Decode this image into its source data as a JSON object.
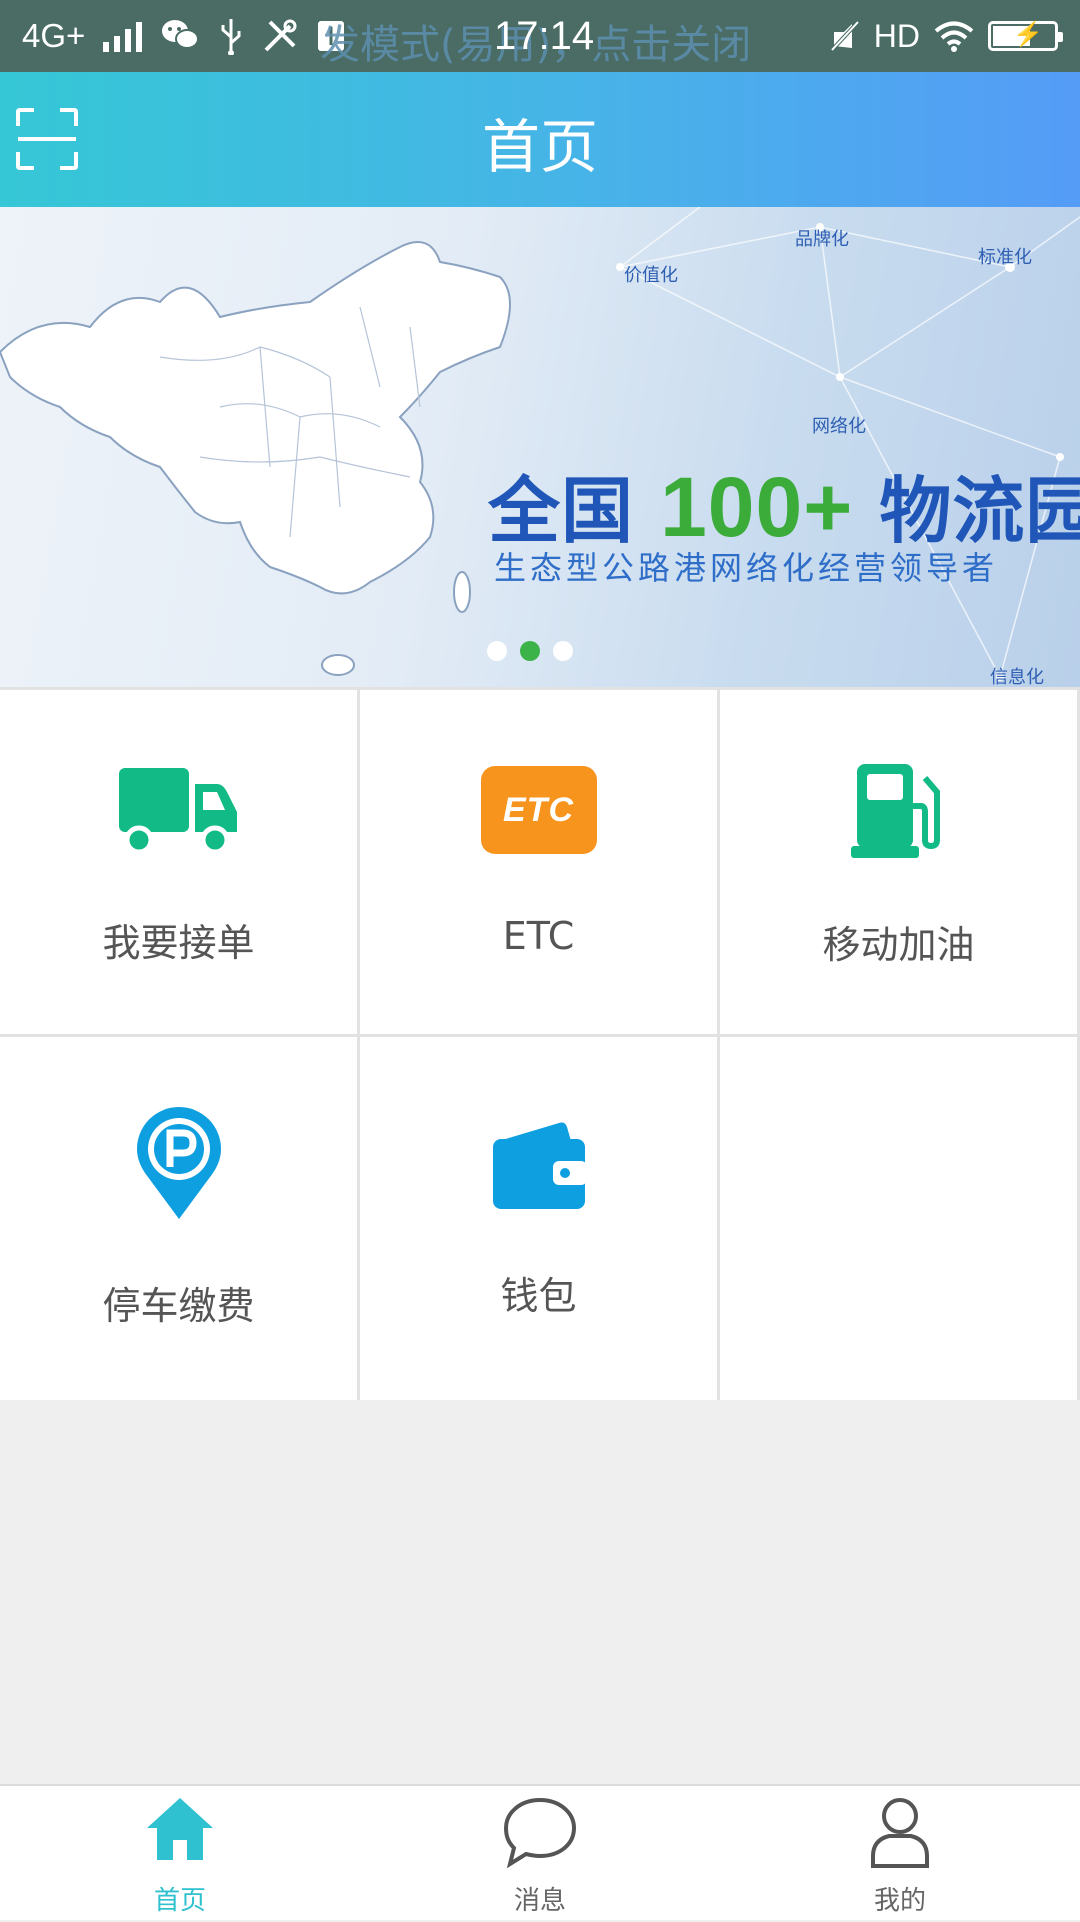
{
  "status_bar": {
    "network": "4G+",
    "time": "17:14",
    "ghost_notice": "发模式(易用)，点击关闭",
    "hd": "HD",
    "icons": [
      "wechat-icon",
      "usb-icon",
      "tools-icon",
      "usb-debug-icon",
      "mute-icon",
      "wifi-icon",
      "battery-icon"
    ]
  },
  "header": {
    "title": "首页",
    "scan_icon": "scan-icon",
    "gradient": [
      "#35c7d6",
      "#559cf7"
    ]
  },
  "banner": {
    "tags": [
      "品牌化",
      "价值化",
      "标准化",
      "网络化",
      "信息化"
    ],
    "slogan_prefix": "全国 ",
    "slogan_highlight": "100+",
    "slogan_suffix": " 物流园",
    "subslogan": "生态型公路港网络化经营领导者",
    "page_count": 3,
    "active_page": 2
  },
  "services": [
    {
      "label": "我要接单",
      "icon": "truck-icon",
      "color": "#12bb86"
    },
    {
      "label": "ETC",
      "icon": "etc-icon",
      "icon_text": "ETC",
      "color": "#f7941d"
    },
    {
      "label": "移动加油",
      "icon": "fuel-pump-icon",
      "color": "#12bb86"
    },
    {
      "label": "停车缴费",
      "icon": "parking-pin-icon",
      "color": "#0e9fe0"
    },
    {
      "label": "钱包",
      "icon": "wallet-icon",
      "color": "#0e9fe0"
    }
  ],
  "bottom_nav": {
    "items": [
      {
        "label": "首页",
        "icon": "home-icon"
      },
      {
        "label": "消息",
        "icon": "chat-bubble-icon"
      },
      {
        "label": "我的",
        "icon": "user-icon"
      }
    ],
    "active_color": "#2fc1cf"
  }
}
